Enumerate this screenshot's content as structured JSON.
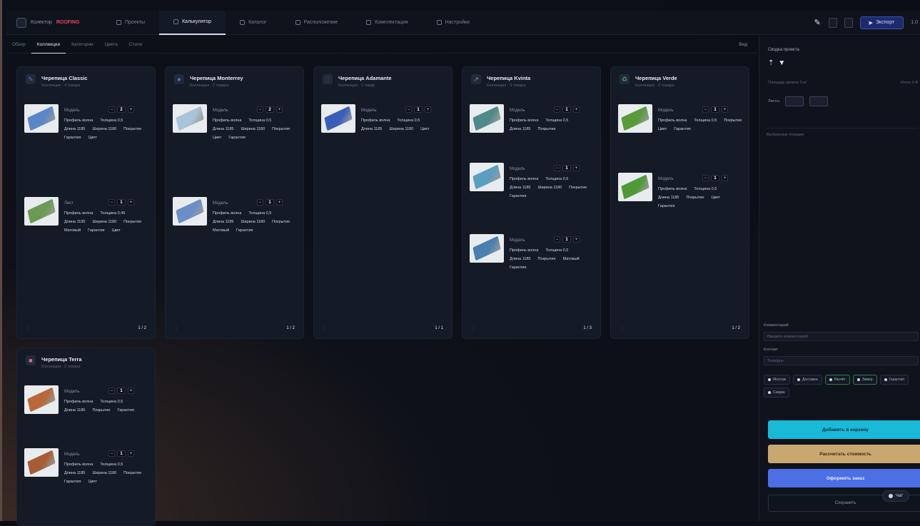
{
  "app": {
    "name": "Колектор",
    "brand": "ROOFING"
  },
  "nav": {
    "tabs": [
      {
        "label": "Проекты"
      },
      {
        "label": "Калькулятор"
      },
      {
        "label": "Каталог"
      },
      {
        "label": "Расположение"
      },
      {
        "label": "Комплектация"
      },
      {
        "label": "Настройки"
      }
    ]
  },
  "toolbar": {
    "publish_label": "Экспорт",
    "version": "1.0"
  },
  "subtabs": [
    {
      "label": "Обзор"
    },
    {
      "label": "Коллекции"
    },
    {
      "label": "Категории"
    },
    {
      "label": "Цвета"
    },
    {
      "label": "Стили"
    }
  ],
  "subbar_right": "Вид",
  "cards": [
    {
      "title": "Черепица Classic",
      "subtitle": "Коллекция · 4 товара",
      "accent": "#4b7bd0",
      "items": [
        {
          "name": "Модель",
          "qty": "2",
          "color": "#5b86c9",
          "specs": [
            "Профиль волна",
            "Толщина 0,5",
            "Длина 1185",
            "Ширина 1180",
            "Покрытие",
            "Гарантия",
            "Цвет"
          ]
        },
        {
          "name": "Лист",
          "qty": "1",
          "color": "#6d9a52",
          "specs": [
            "Профиль волна",
            "Толщина 0,45",
            "Длина 1195",
            "Ширина 1180",
            "Покрытие",
            "Матовый",
            "Гарантия",
            "Цвет"
          ]
        }
      ],
      "footer": "1 / 2"
    },
    {
      "title": "Черепица Monterrey",
      "subtitle": "Коллекция · 2 товара",
      "accent": "#2e84e0",
      "items": [
        {
          "name": "Модель",
          "qty": "2",
          "color": "#a8c4d8",
          "specs": [
            "Профиль волна",
            "Толщина 0,5",
            "Длина 1185",
            "Ширина 1180",
            "Покрытие",
            "Цвет",
            "Гарантия"
          ]
        },
        {
          "name": "Модель",
          "qty": "1",
          "color": "#6a8fc8",
          "specs": [
            "Профиль волна",
            "Толщина 0,5",
            "Длина 1185",
            "Ширина 1180",
            "Покрытие",
            "Матовый",
            "Гарантия"
          ]
        }
      ],
      "footer": "1 / 2"
    },
    {
      "title": "Черепица Adamante",
      "subtitle": "Коллекция · 1 товар",
      "accent": "#3a4a66",
      "items": [
        {
          "name": "Модель",
          "qty": "1",
          "color": "#3a5fb8",
          "specs": [
            "Профиль волна",
            "Толщина 0,5",
            "Длина 1185",
            "Ширина 1180",
            "Цвет"
          ]
        }
      ],
      "footer": "1 / 1"
    },
    {
      "title": "Черепица Kvinta",
      "subtitle": "Коллекция · 3 товара",
      "accent": "#8a93a6",
      "items": [
        {
          "name": "Модель",
          "qty": "1",
          "color": "#4f8a8a",
          "specs": [
            "Профиль волна",
            "Толщина 0,5",
            "Длина 1185",
            "Покрытие"
          ]
        },
        {
          "name": "Модель",
          "qty": "1",
          "color": "#5a9fc0",
          "specs": [
            "Профиль волна",
            "Толщина 0,5",
            "Длина 1185",
            "Ширина 1180",
            "Покрытие",
            "Гарантия"
          ]
        },
        {
          "name": "Модель",
          "qty": "1",
          "color": "#4a7fb0",
          "specs": [
            "Профиль волна",
            "Толщина 0,5",
            "Длина 1185",
            "Покрытие",
            "Матовый",
            "Гарантия"
          ]
        }
      ],
      "footer": "1 / 3"
    },
    {
      "title": "Черепица Verde",
      "subtitle": "Коллекция · 2 товара",
      "accent": "#3fa85a",
      "items": [
        {
          "name": "Модель",
          "qty": "1",
          "color": "#5a9a3a",
          "specs": [
            "Профиль волна",
            "Толщина 0,5",
            "Покрытие",
            "Цвет",
            "Гарантия"
          ]
        },
        {
          "name": "Модель",
          "qty": "1",
          "color": "#4e9a36",
          "specs": [
            "Профиль волна",
            "Толщина 0,5",
            "Длина 1185",
            "Покрытие",
            "Цвет",
            "Гарантия"
          ]
        }
      ],
      "footer": "1 / 2"
    },
    {
      "title": "Черепица Terra",
      "subtitle": "Коллекция · 2 товара",
      "accent": "#e06a8a",
      "items": [
        {
          "name": "Модель",
          "qty": "1",
          "color": "#b8683a",
          "specs": [
            "Профиль волна",
            "Толщина 0,5",
            "Длина 1185",
            "Покрытие",
            "Гарантия"
          ]
        },
        {
          "name": "Модель",
          "qty": "1",
          "color": "#a85c34",
          "specs": [
            "Профиль волна",
            "Толщина 0,5",
            "Длина 1185",
            "Ширина 1180",
            "Покрытие",
            "Гарантия",
            "Цвет"
          ]
        }
      ],
      "footer": "1 / 2"
    }
  ],
  "side": {
    "title": "Сводка проекта",
    "row1_left": "Площадь кровли 0 м²",
    "row1_right": "Итого 0 ₽",
    "row2_label": "Листы",
    "section_label": "Выбранные позиции",
    "field1_label": "Комментарий",
    "field1_value": "Введите комментарий",
    "field2_label": "Контакт",
    "field2_value": "Телефон",
    "chips": [
      {
        "label": "Монтаж",
        "green": false
      },
      {
        "label": "Доставка",
        "green": false
      },
      {
        "label": "Расчёт",
        "green": true
      },
      {
        "label": "Замер",
        "green": true
      },
      {
        "label": "Гарантия",
        "green": false
      },
      {
        "label": "Скидка",
        "green": false
      }
    ],
    "btn_primary": "Добавить в корзину",
    "btn_secondary": "Рассчитать стоимость",
    "btn_tertiary": "Оформить заказ",
    "btn_ghost": "Сохранить",
    "badge": "Чат"
  }
}
